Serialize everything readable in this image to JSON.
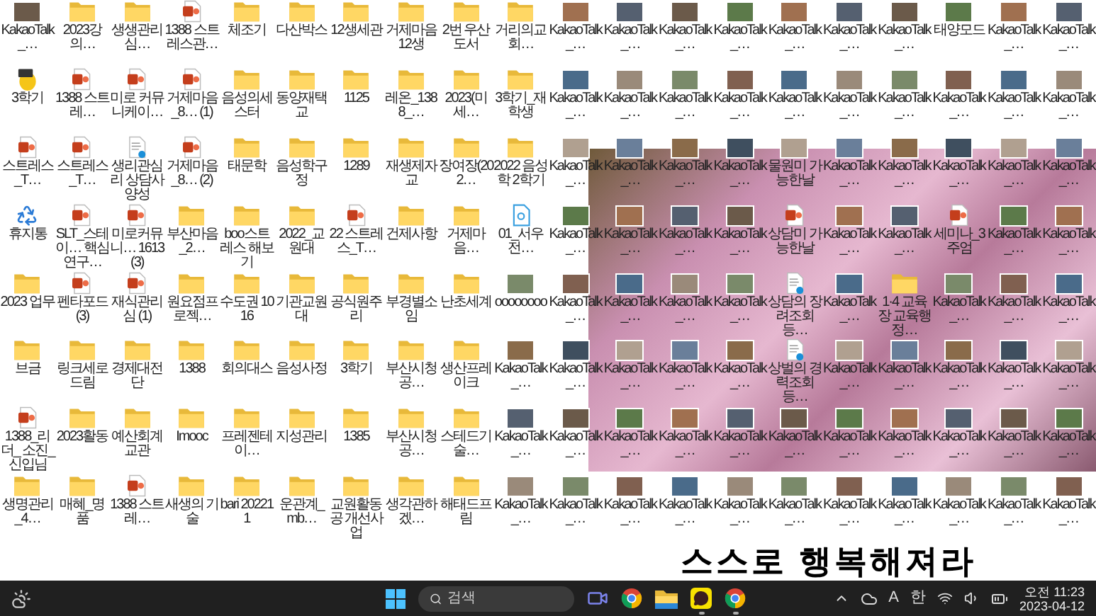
{
  "desktop": {
    "icon_rows": [
      [
        {
          "label": "KakaoTalk_…",
          "kind": "photo"
        },
        {
          "label": "2023강의…",
          "kind": "folder"
        },
        {
          "label": "생생관리심…",
          "kind": "folder"
        },
        {
          "label": "1388 스트레스관…",
          "kind": "ppt"
        },
        {
          "label": "체조기",
          "kind": "folder"
        },
        {
          "label": "다산박스",
          "kind": "folder"
        },
        {
          "label": "12생세관",
          "kind": "folder"
        },
        {
          "label": "거제마음 12생",
          "kind": "folder"
        },
        {
          "label": "2번 우산도서",
          "kind": "folder"
        },
        {
          "label": "거리의교회…",
          "kind": "folder"
        },
        {
          "label": "KakaoTalk_…",
          "kind": "photo"
        },
        {
          "label": "KakaoTalk_…",
          "kind": "photo"
        },
        {
          "label": "KakaoTalk_…",
          "kind": "photo"
        },
        {
          "label": "KakaoTalk_…",
          "kind": "photo"
        },
        {
          "label": "KakaoTalk_…",
          "kind": "photo"
        },
        {
          "label": "KakaoTalk_…",
          "kind": "photo"
        },
        {
          "label": "KakaoTalk_…",
          "kind": "photo"
        },
        {
          "label": "태양모드",
          "kind": "photo"
        },
        {
          "label": "KakaoTalk_…",
          "kind": "photo"
        },
        {
          "label": "KakaoTalk_…",
          "kind": "photo"
        }
      ],
      [
        {
          "label": "3학기",
          "kind": "egg"
        },
        {
          "label": "1388 스트레…",
          "kind": "ppt"
        },
        {
          "label": "미로 커뮤니케이…",
          "kind": "ppt"
        },
        {
          "label": "거제마음_8… (1)",
          "kind": "ppt"
        },
        {
          "label": "음성의세스터",
          "kind": "folder"
        },
        {
          "label": "동양재택교",
          "kind": "folder"
        },
        {
          "label": "1125",
          "kind": "folder"
        },
        {
          "label": "레온_1388_…",
          "kind": "folder"
        },
        {
          "label": "2023(미세…",
          "kind": "folder"
        },
        {
          "label": "3학기_재학생",
          "kind": "folder"
        },
        {
          "label": "KakaoTalk_…",
          "kind": "photo"
        },
        {
          "label": "KakaoTalk_…",
          "kind": "photo"
        },
        {
          "label": "KakaoTalk_…",
          "kind": "photo"
        },
        {
          "label": "KakaoTalk_…",
          "kind": "photo"
        },
        {
          "label": "KakaoTalk_…",
          "kind": "photo"
        },
        {
          "label": "KakaoTalk_…",
          "kind": "photo"
        },
        {
          "label": "KakaoTalk_…",
          "kind": "photo"
        },
        {
          "label": "KakaoTalk_…",
          "kind": "photo"
        },
        {
          "label": "KakaoTalk_…",
          "kind": "photo"
        },
        {
          "label": "KakaoTalk_…",
          "kind": "photo"
        }
      ],
      [
        {
          "label": "스트레스_T…",
          "kind": "ppt"
        },
        {
          "label": "스트레스_T…",
          "kind": "ppt"
        },
        {
          "label": "생리관심리 상담사양성",
          "kind": "doc"
        },
        {
          "label": "거제마음_8… (2)",
          "kind": "ppt"
        },
        {
          "label": "태문학",
          "kind": "folder"
        },
        {
          "label": "음성학구정",
          "kind": "folder"
        },
        {
          "label": "1289",
          "kind": "folder"
        },
        {
          "label": "재생제자교",
          "kind": "folder"
        },
        {
          "label": "장여장(202…",
          "kind": "folder"
        },
        {
          "label": "2022 음성학 2학기",
          "kind": "folder"
        },
        {
          "label": "KakaoTalk_…",
          "kind": "photo"
        },
        {
          "label": "KakaoTalk_…",
          "kind": "photo"
        },
        {
          "label": "KakaoTalk_…",
          "kind": "photo"
        },
        {
          "label": "KakaoTalk_…",
          "kind": "photo"
        },
        {
          "label": "물원미 가능한날",
          "kind": "photo"
        },
        {
          "label": "KakaoTalk_…",
          "kind": "photo"
        },
        {
          "label": "KakaoTalk_…",
          "kind": "photo"
        },
        {
          "label": "KakaoTalk_…",
          "kind": "photo"
        },
        {
          "label": "KakaoTalk_…",
          "kind": "photo"
        },
        {
          "label": "KakaoTalk_…",
          "kind": "photo"
        }
      ],
      [
        {
          "label": "휴지통",
          "kind": "recycle"
        },
        {
          "label": "SLT_스테이… 핵심연구…",
          "kind": "ppt"
        },
        {
          "label": "미로커뮤니… 1613 (3)",
          "kind": "ppt"
        },
        {
          "label": "부산마음_2…",
          "kind": "folder"
        },
        {
          "label": "boo스트레스 해보기",
          "kind": "folder"
        },
        {
          "label": "2022_교원대",
          "kind": "folder"
        },
        {
          "label": "22 스트레스_T…",
          "kind": "ppt"
        },
        {
          "label": "건제사항",
          "kind": "folder"
        },
        {
          "label": "거제마음…",
          "kind": "folder"
        },
        {
          "label": "01_서우전…",
          "kind": "hwp"
        },
        {
          "label": "KakaoTalk_…",
          "kind": "photo"
        },
        {
          "label": "KakaoTalk_…",
          "kind": "photo"
        },
        {
          "label": "KakaoTalk_…",
          "kind": "photo"
        },
        {
          "label": "KakaoTalk_…",
          "kind": "photo"
        },
        {
          "label": "상담미 가능한날",
          "kind": "ppt"
        },
        {
          "label": "KakaoTalk_…",
          "kind": "photo"
        },
        {
          "label": "KakaoTalk_…",
          "kind": "photo"
        },
        {
          "label": "세미나_3주엄",
          "kind": "ppt"
        },
        {
          "label": "KakaoTalk_…",
          "kind": "photo"
        },
        {
          "label": "KakaoTalk_…",
          "kind": "photo"
        }
      ],
      [
        {
          "label": "2023 업무",
          "kind": "folder"
        },
        {
          "label": "펜타포드 (3)",
          "kind": "ppt"
        },
        {
          "label": "재식관리심 (1)",
          "kind": "ppt"
        },
        {
          "label": "원요점프로젝…",
          "kind": "folder"
        },
        {
          "label": "수도권 1016",
          "kind": "folder"
        },
        {
          "label": "기관교원대",
          "kind": "folder"
        },
        {
          "label": "공식원주리",
          "kind": "folder"
        },
        {
          "label": "부경별소임",
          "kind": "folder"
        },
        {
          "label": "난초세계",
          "kind": "folder"
        },
        {
          "label": "oooooooo",
          "kind": "photo"
        },
        {
          "label": "KakaoTalk_…",
          "kind": "photo"
        },
        {
          "label": "KakaoTalk_…",
          "kind": "photo"
        },
        {
          "label": "KakaoTalk_…",
          "kind": "photo"
        },
        {
          "label": "KakaoTalk_…",
          "kind": "photo"
        },
        {
          "label": "상담의 장려조회 등…",
          "kind": "doc"
        },
        {
          "label": "KakaoTalk_…",
          "kind": "photo"
        },
        {
          "label": "1·4 교육장 교육행정…",
          "kind": "folder"
        },
        {
          "label": "KakaoTalk_…",
          "kind": "photo"
        },
        {
          "label": "KakaoTalk_…",
          "kind": "photo"
        },
        {
          "label": "KakaoTalk_…",
          "kind": "photo"
        }
      ],
      [
        {
          "label": "브금",
          "kind": "folder"
        },
        {
          "label": "링크세로드림",
          "kind": "folder"
        },
        {
          "label": "경제대전단",
          "kind": "folder"
        },
        {
          "label": "1388",
          "kind": "folder"
        },
        {
          "label": "회의대스",
          "kind": "folder"
        },
        {
          "label": "음성사정",
          "kind": "folder"
        },
        {
          "label": "3학기",
          "kind": "folder"
        },
        {
          "label": "부산시청공…",
          "kind": "folder"
        },
        {
          "label": "생산프레이크",
          "kind": "folder"
        },
        {
          "label": "KakaoTalk_…",
          "kind": "photo"
        },
        {
          "label": "KakaoTalk_…",
          "kind": "photo"
        },
        {
          "label": "KakaoTalk_…",
          "kind": "photo"
        },
        {
          "label": "KakaoTalk_…",
          "kind": "photo"
        },
        {
          "label": "KakaoTalk_…",
          "kind": "photo"
        },
        {
          "label": "상벌의 경력조회 등…",
          "kind": "doc"
        },
        {
          "label": "KakaoTalk_…",
          "kind": "photo"
        },
        {
          "label": "KakaoTalk_…",
          "kind": "photo"
        },
        {
          "label": "KakaoTalk_…",
          "kind": "photo"
        },
        {
          "label": "KakaoTalk_…",
          "kind": "photo"
        },
        {
          "label": "KakaoTalk_…",
          "kind": "photo"
        }
      ],
      [
        {
          "label": "1388_리더_ 소진_신입님",
          "kind": "ppt"
        },
        {
          "label": "2023활동",
          "kind": "folder"
        },
        {
          "label": "예산회계교관",
          "kind": "folder"
        },
        {
          "label": "Imooc",
          "kind": "folder"
        },
        {
          "label": "프레젠테이…",
          "kind": "folder"
        },
        {
          "label": "지성관리",
          "kind": "folder"
        },
        {
          "label": "1385",
          "kind": "folder"
        },
        {
          "label": "부산시청공…",
          "kind": "folder"
        },
        {
          "label": "스테드기술…",
          "kind": "folder"
        },
        {
          "label": "KakaoTalk_…",
          "kind": "photo"
        },
        {
          "label": "KakaoTalk_…",
          "kind": "photo"
        },
        {
          "label": "KakaoTalk_…",
          "kind": "photo"
        },
        {
          "label": "KakaoTalk_…",
          "kind": "photo"
        },
        {
          "label": "KakaoTalk_…",
          "kind": "photo"
        },
        {
          "label": "KakaoTalk_…",
          "kind": "photo"
        },
        {
          "label": "KakaoTalk_…",
          "kind": "photo"
        },
        {
          "label": "KakaoTalk_…",
          "kind": "photo"
        },
        {
          "label": "KakaoTalk_…",
          "kind": "photo"
        },
        {
          "label": "KakaoTalk_…",
          "kind": "photo"
        },
        {
          "label": "KakaoTalk_…",
          "kind": "photo"
        }
      ],
      [
        {
          "label": "생명관리_4…",
          "kind": "folder"
        },
        {
          "label": "매혜_명품",
          "kind": "folder"
        },
        {
          "label": "1388 스트레…",
          "kind": "ppt"
        },
        {
          "label": "새생의 기술",
          "kind": "folder"
        },
        {
          "label": "bari 202211",
          "kind": "folder"
        },
        {
          "label": "운관계_mb…",
          "kind": "folder"
        },
        {
          "label": "교원활동공 개선사업",
          "kind": "folder"
        },
        {
          "label": "생각관하겠…",
          "kind": "folder"
        },
        {
          "label": "해태드프림",
          "kind": "folder"
        },
        {
          "label": "KakaoTalk_…",
          "kind": "photo"
        },
        {
          "label": "KakaoTalk_…",
          "kind": "photo"
        },
        {
          "label": "KakaoTalk_…",
          "kind": "photo"
        },
        {
          "label": "KakaoTalk_…",
          "kind": "photo"
        },
        {
          "label": "KakaoTalk_…",
          "kind": "photo"
        },
        {
          "label": "KakaoTalk_…",
          "kind": "photo"
        },
        {
          "label": "KakaoTalk_…",
          "kind": "photo"
        },
        {
          "label": "KakaoTalk_…",
          "kind": "photo"
        },
        {
          "label": "KakaoTalk_…",
          "kind": "photo"
        },
        {
          "label": "KakaoTalk_…",
          "kind": "photo"
        },
        {
          "label": "KakaoTalk_…",
          "kind": "photo"
        }
      ]
    ],
    "handwriting": "스스로 행복해져라"
  },
  "taskbar": {
    "search": {
      "placeholder": "검색"
    },
    "apps": [
      {
        "kind": "video",
        "running": false
      },
      {
        "kind": "chrome",
        "running": false
      },
      {
        "kind": "explorer",
        "running": false
      },
      {
        "kind": "kakao",
        "running": true
      },
      {
        "kind": "chrome",
        "running": true
      }
    ],
    "tray_labels": [
      "A",
      "한"
    ],
    "clock": {
      "time": "오전 11:23",
      "date": "2023-04-12"
    }
  }
}
